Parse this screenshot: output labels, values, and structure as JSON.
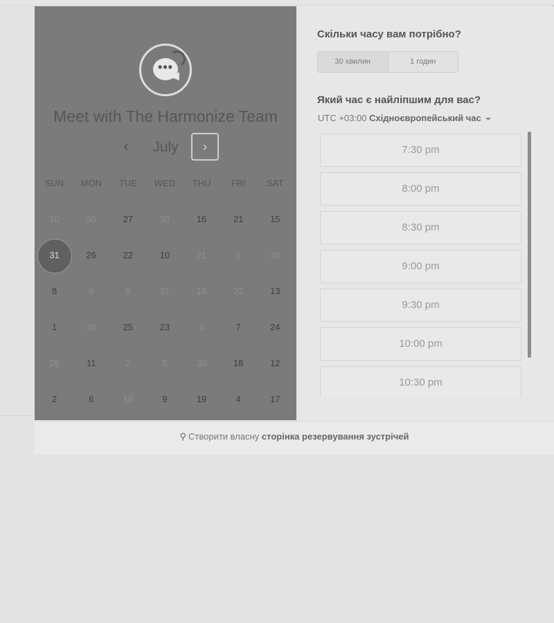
{
  "calendar": {
    "title": "Meet with The Harmonize Team",
    "month": "July",
    "prev_icon": "‹",
    "next_icon": "›",
    "days_of_week": [
      "SUN",
      "MON",
      "TUE",
      "WED",
      "THU",
      "FRI",
      "SAT"
    ],
    "weeks": [
      [
        {
          "d": "10",
          "s": "off"
        },
        {
          "d": "30",
          "s": "off"
        },
        {
          "d": "27",
          "s": "on"
        },
        {
          "d": "30",
          "s": "off"
        },
        {
          "d": "16",
          "s": "on"
        },
        {
          "d": "21",
          "s": "on"
        },
        {
          "d": "15",
          "s": "on"
        }
      ],
      [
        {
          "d": "31",
          "s": "sel"
        },
        {
          "d": "26",
          "s": "on"
        },
        {
          "d": "22",
          "s": "on"
        },
        {
          "d": "10",
          "s": "on"
        },
        {
          "d": "21",
          "s": "off"
        },
        {
          "d": "5",
          "s": "off"
        },
        {
          "d": "30",
          "s": "off"
        }
      ],
      [
        {
          "d": "8",
          "s": "on"
        },
        {
          "d": "9",
          "s": "off"
        },
        {
          "d": "9",
          "s": "off"
        },
        {
          "d": "31",
          "s": "off"
        },
        {
          "d": "18",
          "s": "off"
        },
        {
          "d": "22",
          "s": "off"
        },
        {
          "d": "13",
          "s": "on"
        }
      ],
      [
        {
          "d": "1",
          "s": "on"
        },
        {
          "d": "30",
          "s": "off"
        },
        {
          "d": "25",
          "s": "on"
        },
        {
          "d": "23",
          "s": "on"
        },
        {
          "d": "6",
          "s": "off"
        },
        {
          "d": "7",
          "s": "on"
        },
        {
          "d": "24",
          "s": "on"
        }
      ],
      [
        {
          "d": "26",
          "s": "off"
        },
        {
          "d": "11",
          "s": "on"
        },
        {
          "d": "2",
          "s": "off"
        },
        {
          "d": "5",
          "s": "off"
        },
        {
          "d": "30",
          "s": "off"
        },
        {
          "d": "18",
          "s": "on"
        },
        {
          "d": "12",
          "s": "on"
        }
      ],
      [
        {
          "d": "2",
          "s": "on"
        },
        {
          "d": "6",
          "s": "on"
        },
        {
          "d": "18",
          "s": "off"
        },
        {
          "d": "9",
          "s": "on"
        },
        {
          "d": "19",
          "s": "on"
        },
        {
          "d": "4",
          "s": "on"
        },
        {
          "d": "17",
          "s": "on"
        }
      ]
    ]
  },
  "duration": {
    "question": "Скільки часу вам потрібно?",
    "options": [
      "30 хвилин",
      "1 годин"
    ]
  },
  "time": {
    "question": "Який час є найліпшим для вас?",
    "timezone_prefix": "UTC +03:00",
    "timezone_name": "Східноєвропейський час",
    "slots": [
      "7:30 pm",
      "8:00 pm",
      "8:30 pm",
      "9:00 pm",
      "9:30 pm",
      "10:00 pm",
      "10:30 pm"
    ]
  },
  "footer": {
    "icon": "hubspot-sprocket-icon",
    "text": "Створити власну",
    "link": "сторінка резервування зустрічей"
  },
  "colors": {
    "calendar_panel": "#7b7b7b",
    "selected_day": "#606060",
    "time_panel": "#e7e7e7"
  }
}
